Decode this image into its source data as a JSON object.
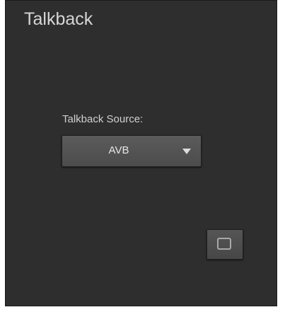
{
  "panel": {
    "title": "Talkback"
  },
  "talkback_source": {
    "label": "Talkback Source:",
    "selected": "AVB",
    "caret_icon": "triangle-down-icon"
  },
  "toggle_button": {
    "icon": "square-outline-icon"
  },
  "colors": {
    "panel_bg": "#2e2e2e",
    "control_bg": "#555555",
    "text": "#d6d6d6"
  }
}
